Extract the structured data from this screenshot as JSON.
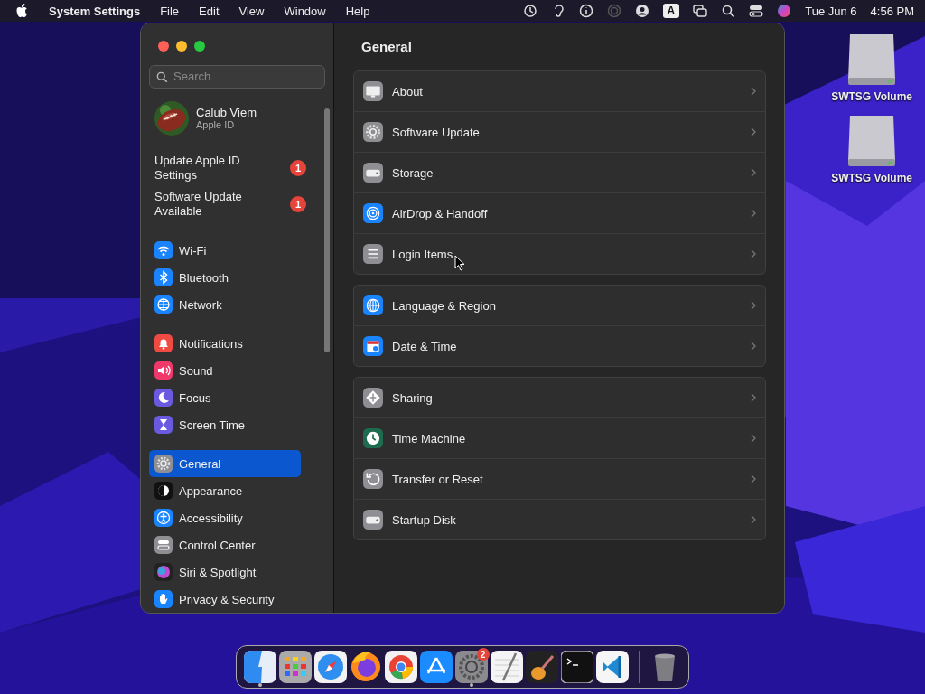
{
  "menu_bar": {
    "app_name": "System Settings",
    "menus": [
      "File",
      "Edit",
      "View",
      "Window",
      "Help"
    ],
    "input_source": "A",
    "date": "Tue Jun 6",
    "time": "4:56 PM"
  },
  "desktop_icons": [
    {
      "label": "SWTSG Volume"
    },
    {
      "label": "SWTSG Volume"
    }
  ],
  "window": {
    "title": "General",
    "sidebar": {
      "search": {
        "placeholder": "Search"
      },
      "account": {
        "name": "Calub Viem",
        "subtitle": "Apple ID"
      },
      "alerts": [
        {
          "text": "Update Apple ID Settings",
          "badge": "1"
        },
        {
          "text": "Software Update Available",
          "badge": "1"
        }
      ],
      "groups": [
        [
          {
            "label": "Wi-Fi",
            "kind": "wifi",
            "selected": false
          },
          {
            "label": "Bluetooth",
            "kind": "bluetooth",
            "selected": false
          },
          {
            "label": "Network",
            "kind": "network",
            "selected": false
          }
        ],
        [
          {
            "label": "Notifications",
            "kind": "notifications",
            "selected": false
          },
          {
            "label": "Sound",
            "kind": "sound",
            "selected": false
          },
          {
            "label": "Focus",
            "kind": "focus",
            "selected": false
          },
          {
            "label": "Screen Time",
            "kind": "screentime",
            "selected": false
          }
        ],
        [
          {
            "label": "General",
            "kind": "general",
            "selected": true
          },
          {
            "label": "Appearance",
            "kind": "appearance",
            "selected": false
          },
          {
            "label": "Accessibility",
            "kind": "accessibility",
            "selected": false
          },
          {
            "label": "Control Center",
            "kind": "control",
            "selected": false
          },
          {
            "label": "Siri & Spotlight",
            "kind": "siri",
            "selected": false
          },
          {
            "label": "Privacy & Security",
            "kind": "privacy",
            "selected": false
          }
        ]
      ]
    },
    "groups": [
      [
        {
          "label": "About",
          "kind": "about"
        },
        {
          "label": "Software Update",
          "kind": "update"
        },
        {
          "label": "Storage",
          "kind": "storage"
        },
        {
          "label": "AirDrop & Handoff",
          "kind": "airdrop"
        },
        {
          "label": "Login Items",
          "kind": "login"
        }
      ],
      [
        {
          "label": "Language & Region",
          "kind": "language"
        },
        {
          "label": "Date & Time",
          "kind": "date"
        }
      ],
      [
        {
          "label": "Sharing",
          "kind": "sharing"
        },
        {
          "label": "Time Machine",
          "kind": "timemachine"
        },
        {
          "label": "Transfer or Reset",
          "kind": "reset"
        },
        {
          "label": "Startup Disk",
          "kind": "startup"
        }
      ]
    ]
  },
  "dock": {
    "apps": [
      {
        "kind": "finder",
        "running": true
      },
      {
        "kind": "launchpad",
        "running": false
      },
      {
        "kind": "safari",
        "running": false
      },
      {
        "kind": "firefox",
        "running": false
      },
      {
        "kind": "chrome",
        "running": false
      },
      {
        "kind": "appstore",
        "running": false
      },
      {
        "kind": "settings",
        "running": true,
        "badge": "2"
      },
      {
        "kind": "textedit",
        "running": false
      },
      {
        "kind": "garageband",
        "running": false
      },
      {
        "kind": "terminal",
        "running": false
      },
      {
        "kind": "vscode",
        "running": false
      }
    ],
    "trash": {
      "kind": "trash",
      "running": false
    }
  }
}
